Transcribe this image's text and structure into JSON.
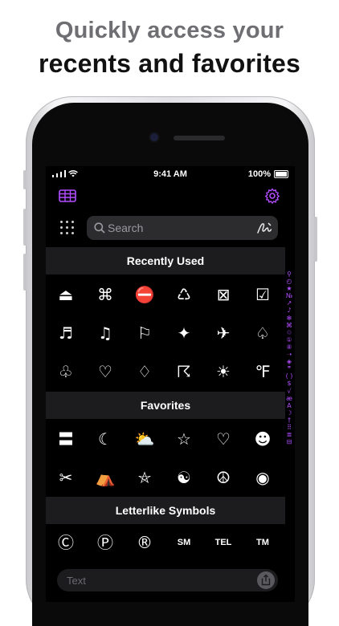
{
  "headline": {
    "line1": "Quickly access your",
    "line2": "recents and favorites"
  },
  "statusbar": {
    "time": "9:41 AM",
    "battery": "100%"
  },
  "toolbar": {
    "left_icon": "table-icon",
    "right_icon": "gear-icon",
    "accent": "#b14dff"
  },
  "search": {
    "placeholder": "Search"
  },
  "sections": [
    {
      "title": "Recently Used",
      "symbols": [
        "⏏",
        "⌘",
        "⛔",
        "♺",
        "⊠",
        "☑",
        "♬",
        "♫",
        "⚐",
        "✦",
        "✈",
        "♤",
        "♧",
        "♡",
        "♢",
        "☈",
        "☀",
        "℉"
      ]
    },
    {
      "title": "Favorites",
      "symbols": [
        "〓",
        "☾",
        "⛅",
        "☆",
        "♡",
        "☻",
        "✂",
        "⛺",
        "⛤",
        "☯",
        "☮",
        "◉"
      ]
    },
    {
      "title": "Letterlike Symbols",
      "symbols": [
        "Ⓒ",
        "Ⓟ",
        "®",
        "SM",
        "TEL",
        "TM"
      ]
    }
  ],
  "alpha_index": [
    "⚲",
    "◴",
    "★",
    "№",
    "↗",
    "♪",
    "✻",
    "⌘",
    "♲",
    "①",
    "⑧",
    "➝",
    "◈",
    "❞",
    "( )",
    "$",
    "√",
    "æ",
    "A",
    "☽",
    "†",
    "⠿",
    "≣",
    "⊟"
  ],
  "text_input": {
    "placeholder": "Text"
  }
}
